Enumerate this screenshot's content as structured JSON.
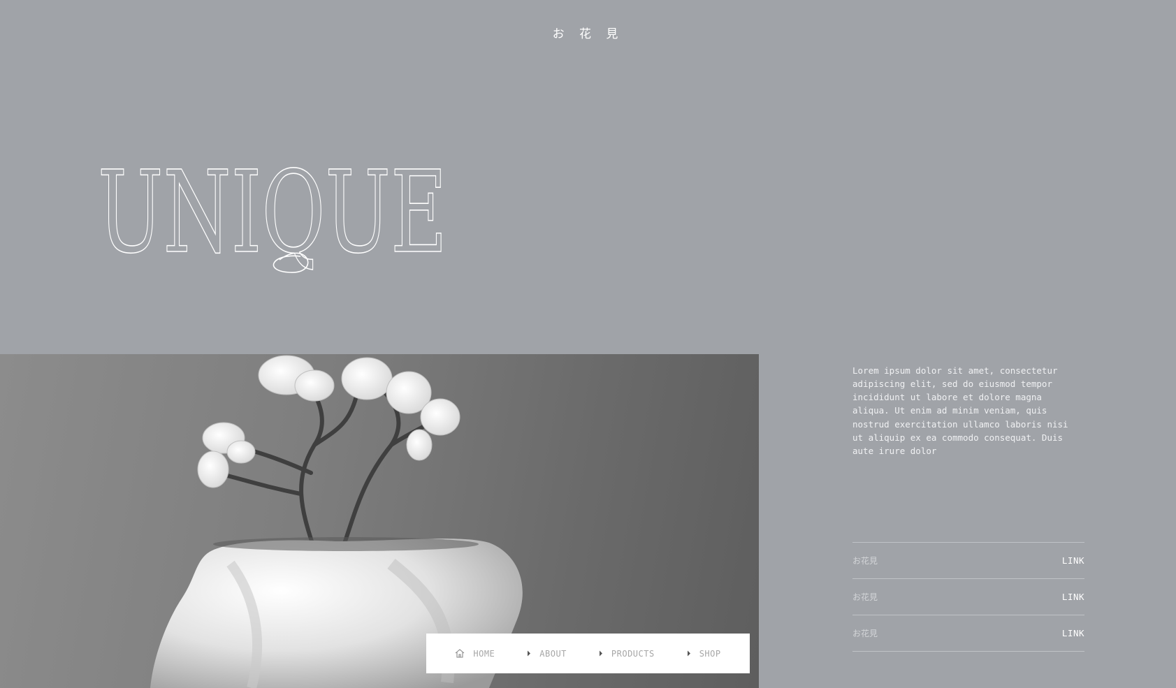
{
  "header": {
    "brand": "お 花 見"
  },
  "hero": {
    "title": "UNIQUE"
  },
  "description": "Lorem ipsum dolor sit amet, consectetur adipiscing elit, sed do eiusmod tempor incididunt ut labore et dolore magna aliqua. Ut enim ad minim veniam, quis nostrud exercitation ullamco laboris nisi ut aliquip ex ea commodo consequat. Duis aute irure dolor",
  "nav": {
    "items": [
      {
        "label": "HOME",
        "icon": "home-icon"
      },
      {
        "label": "ABOUT",
        "icon": "caret-right-icon"
      },
      {
        "label": "PRODUCTS",
        "icon": "caret-right-icon"
      },
      {
        "label": "SHOP",
        "icon": "caret-right-icon"
      }
    ]
  },
  "links": [
    {
      "label": "お花見",
      "action": "LINK"
    },
    {
      "label": "お花見",
      "action": "LINK"
    },
    {
      "label": "お花見",
      "action": "LINK"
    }
  ],
  "colors": {
    "background": "#a0a3a8",
    "text": "#ffffff",
    "nav_bg": "#ffffff",
    "nav_text": "#a6a6a6"
  }
}
